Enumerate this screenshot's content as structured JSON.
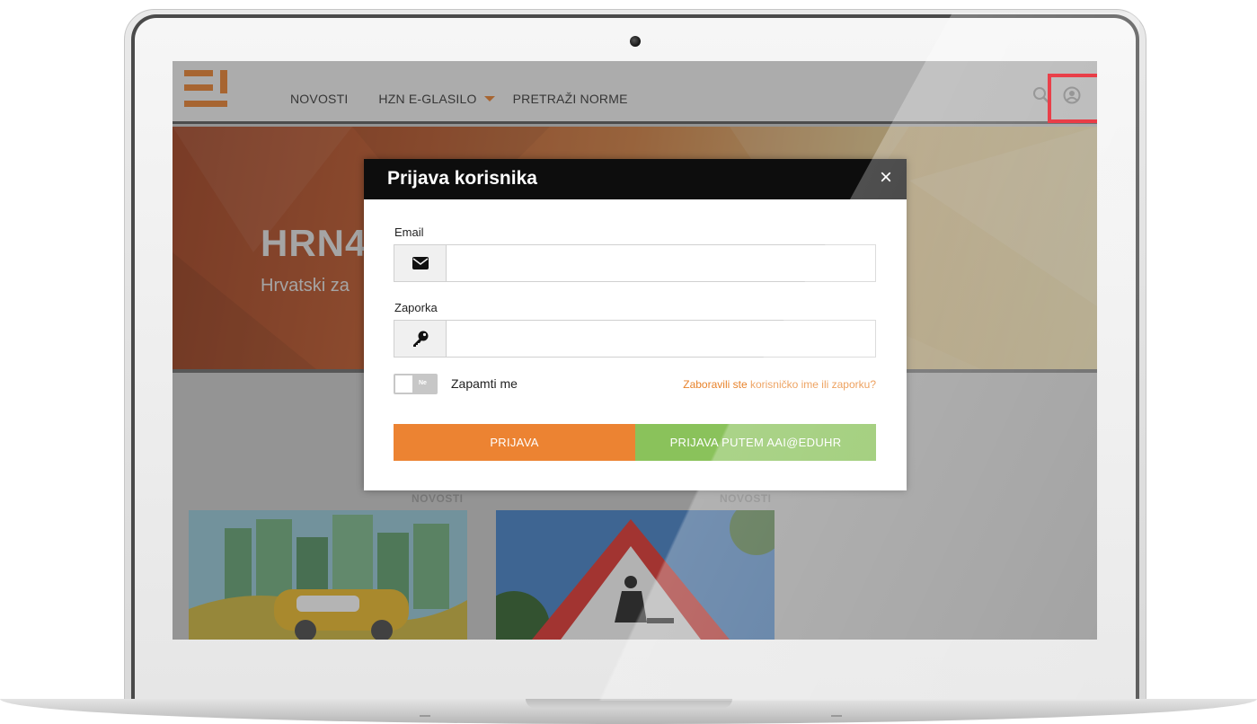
{
  "nav": {
    "items": [
      "NOVOSTI",
      "HZN E-GLASILO",
      "PRETRAŽI NORME"
    ]
  },
  "hero": {
    "title": "HRN4",
    "subtitle": "Hrvatski za"
  },
  "cards": [
    {
      "label": "NOVOSTI"
    },
    {
      "label": "NOVOSTI"
    }
  ],
  "modal": {
    "title": "Prijava korisnika",
    "close_symbol": "×",
    "email_label": "Email",
    "email_value": "",
    "password_label": "Zaporka",
    "password_value": "",
    "toggle_text": "Ne",
    "remember_label": "Zapamti me",
    "forgot_link": "Zaboravili ste korisničko ime ili zaporku?",
    "login_button": "PRIJAVA",
    "aai_button": "PRIJAVA PUTEM AAI@EDUHR"
  },
  "icons": {
    "search": "search-icon",
    "user": "user-icon",
    "email": "envelope-icon",
    "password": "key-icon"
  },
  "colors": {
    "accent_orange": "#ec8332",
    "accent_green": "#8ac25b",
    "highlight_red": "#e30613",
    "modal_header": "#0d0d0d"
  }
}
